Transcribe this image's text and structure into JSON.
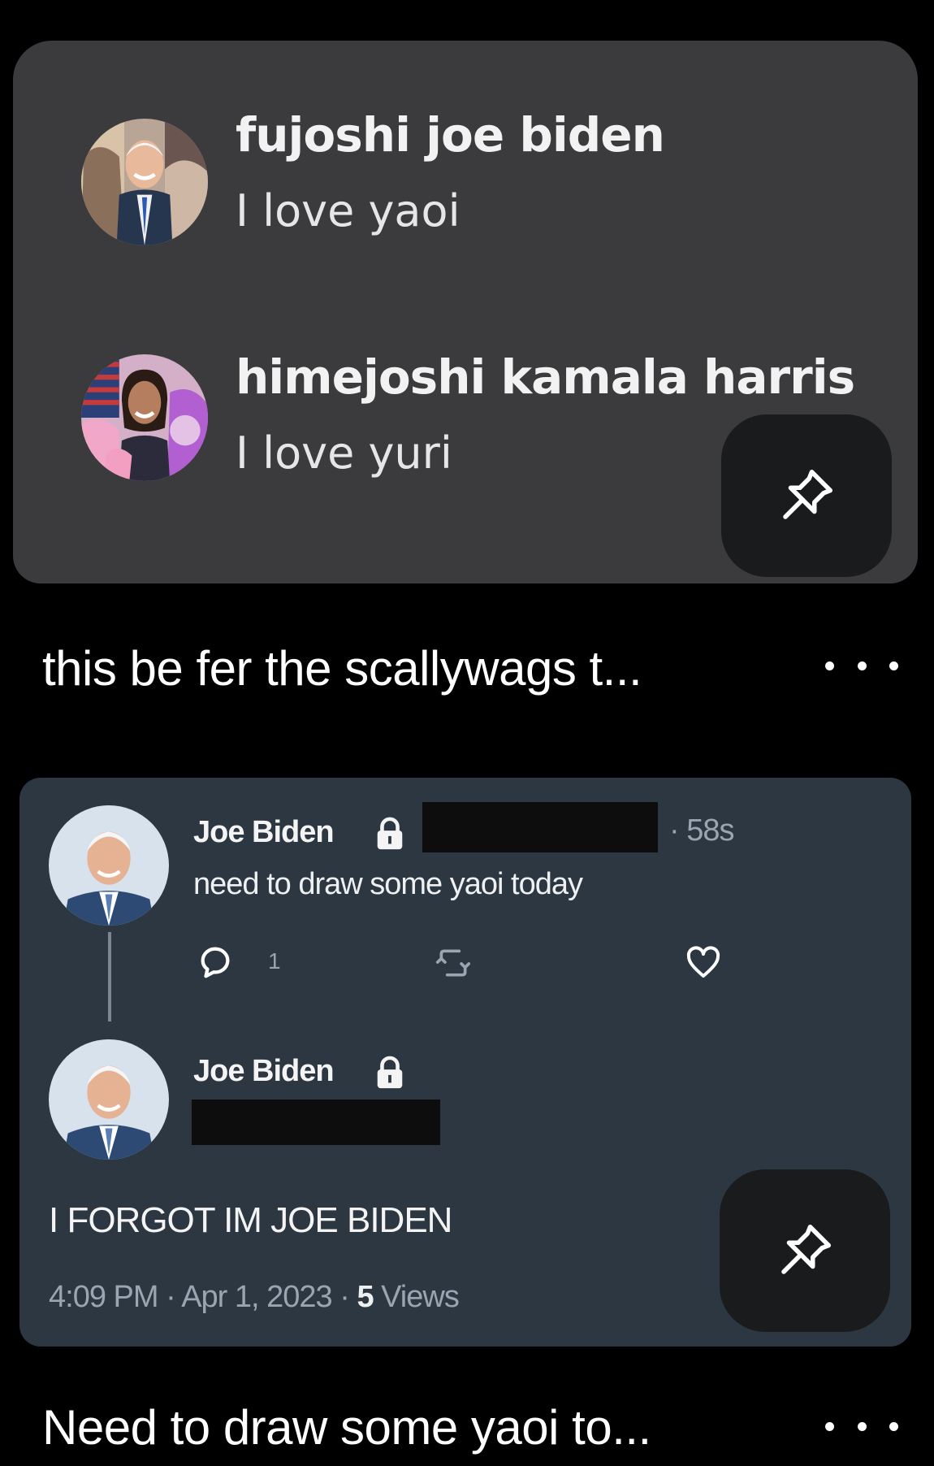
{
  "chat_list": {
    "items": [
      {
        "name": "fujoshi joe biden",
        "status": "I love yaoi",
        "avatar": "biden-collage-avatar"
      },
      {
        "name": "himejoshi kamala harris",
        "status": "I love yuri",
        "avatar": "harris-collage-avatar"
      }
    ],
    "pin_icon": "pushpin-icon"
  },
  "post1": {
    "caption": "this be fer the scallywags t...",
    "more_icon": "more-horizontal-icon"
  },
  "tweet": {
    "author": "Joe Biden",
    "lock_icon": "lock-icon",
    "time_ago": "· 58s",
    "text": "need to draw some yaoi today",
    "reply_count": "1",
    "reply_icon": "reply-bubble-icon",
    "retweet_icon": "retweet-icon",
    "like_icon": "heart-icon",
    "reply_author": "Joe Biden",
    "reply_text": "I FORGOT IM JOE BIDEN",
    "timestamp": "4:09 PM · Apr 1, 2023 · ",
    "views_count": "5",
    "views_label": " Views"
  },
  "post2": {
    "caption": "Need to draw some yaoi to...",
    "more_icon": "more-horizontal-icon"
  },
  "colors": {
    "card_gray": "#3b3b3d",
    "tweet_bg": "#2c3742",
    "pin_btn": "#1a1b1d"
  }
}
